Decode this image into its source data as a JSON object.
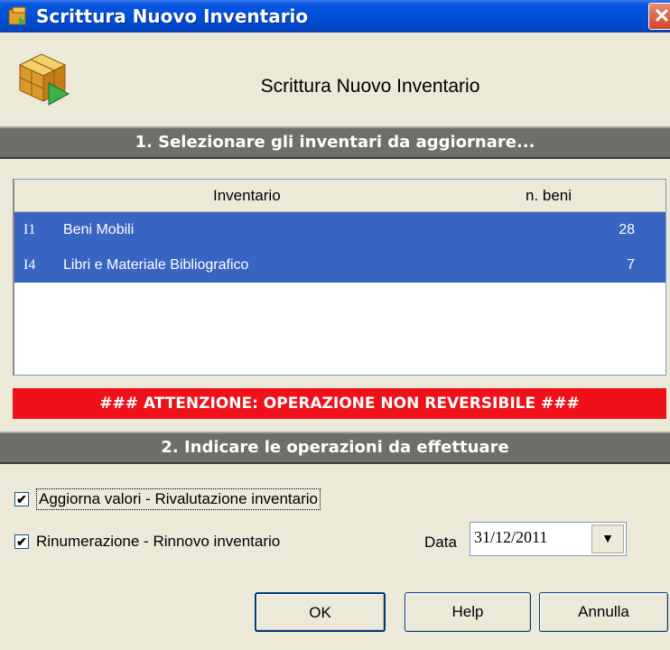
{
  "window": {
    "title": "Scrittura Nuovo Inventario",
    "close_glyph": "✕"
  },
  "header": {
    "title": "Scrittura Nuovo Inventario",
    "icon": "cube-icon"
  },
  "section1": {
    "title": "1. Selezionare gli inventari da aggiornare..."
  },
  "list": {
    "columns": [
      "Inventario",
      "n. beni"
    ],
    "rows": [
      {
        "code": "I1",
        "name": "Beni Mobili",
        "count": "28",
        "selected": true
      },
      {
        "code": "I4",
        "name": "Libri e Materiale Bibliografico",
        "count": "7",
        "selected": true
      }
    ]
  },
  "warning": {
    "text": "### ATTENZIONE: OPERAZIONE NON REVERSIBILE ###"
  },
  "section2": {
    "title": "2. Indicare le operazioni da effettuare"
  },
  "options": {
    "aggiorna": {
      "label": "Aggiorna valori - Rivalutazione inventario",
      "checked": true
    },
    "rinumerazione": {
      "label": "Rinumerazione - Rinnovo inventario",
      "checked": true
    }
  },
  "date": {
    "label": "Data",
    "value": "31/12/2011"
  },
  "buttons": {
    "ok": "OK",
    "help": "Help",
    "cancel": "Annulla"
  },
  "check_glyph": "✔",
  "dropdown_glyph": "▼",
  "colors": {
    "title_bar": "#0050d8",
    "selection": "#3a64c2",
    "warning": "#f0101a",
    "section_bar": "#6f6e6a"
  }
}
